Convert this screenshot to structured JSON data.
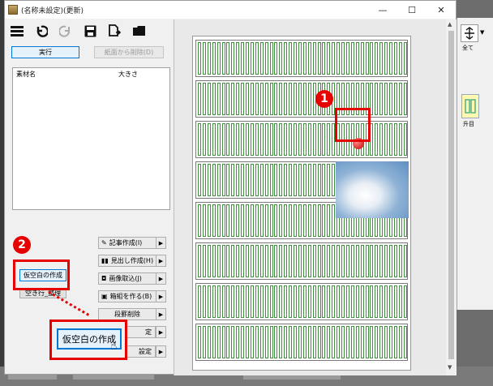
{
  "window": {
    "title": "(名称未設定)(更新)",
    "minimize": "—",
    "maximize": "☐",
    "close": "✕"
  },
  "toolbar": {
    "menu_icon": "menu-icon",
    "undo_icon": "undo-icon",
    "redo_icon": "redo-icon",
    "save_icon": "save-icon",
    "export_icon": "export-icon",
    "folder_icon": "folder-icon"
  },
  "actions": {
    "run_label": "実行",
    "remove_label": "紙面から削除(D)"
  },
  "list": {
    "col_name": "素材名",
    "col_size": "大きさ"
  },
  "side_buttons": {
    "article": "記事作成(I)",
    "headline": "見出し作成(H)",
    "image": "画像取込(J)",
    "box": "箱組を作る(B)",
    "delete_para": "段罫削除",
    "settings_partial": "定",
    "settings_partial2": "設定"
  },
  "left_buttons": {
    "temp_blank": "仮空白の作成",
    "empty_line": "空き行_整理"
  },
  "zoom_callout": {
    "label": "仮空白の作成"
  },
  "badges": {
    "one": "1",
    "two": "2"
  },
  "right_panel": {
    "fit_label": "全て",
    "grid_label": "升目"
  },
  "colors": {
    "accent_red": "#e60000",
    "grid_green": "#3f8f3f"
  }
}
